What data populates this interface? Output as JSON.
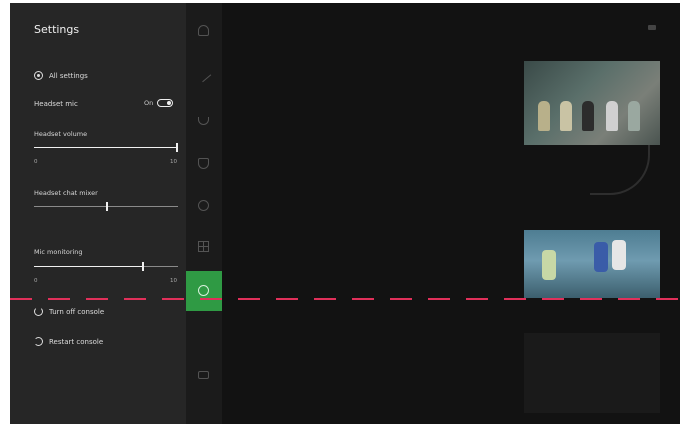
{
  "settings": {
    "title": "Settings",
    "all_settings": "All settings",
    "headset_mic": {
      "label": "Headset mic",
      "state": "On",
      "on": true
    },
    "headset_volume": {
      "label": "Headset volume",
      "min": "0",
      "max": "10",
      "value_fraction": 1.0
    },
    "headset_chat_mixer": {
      "label": "Headset chat mixer",
      "min": "",
      "max": "",
      "value_fraction": 0.5
    },
    "mic_monitoring": {
      "label": "Mic monitoring",
      "min": "0",
      "max": "10",
      "value_fraction": 0.75
    },
    "turn_off": "Turn off console",
    "restart": "Restart console"
  },
  "rail": {
    "icons": [
      "person-icon",
      "pen-icon",
      "trophy-icon",
      "shield-icon",
      "search-icon",
      "store-icon",
      "gear-icon",
      "tv-icon"
    ],
    "active": "gear-icon",
    "accent": "#2f9a44"
  },
  "background": {
    "tabs": [
      "",
      "",
      ""
    ],
    "profile": "",
    "card1_caption": "",
    "section_heading": "",
    "card2_caption": "",
    "tile_text": ""
  },
  "colors": {
    "panel": "#262626",
    "screen": "#121212",
    "dashed_line": "#e0305a"
  }
}
